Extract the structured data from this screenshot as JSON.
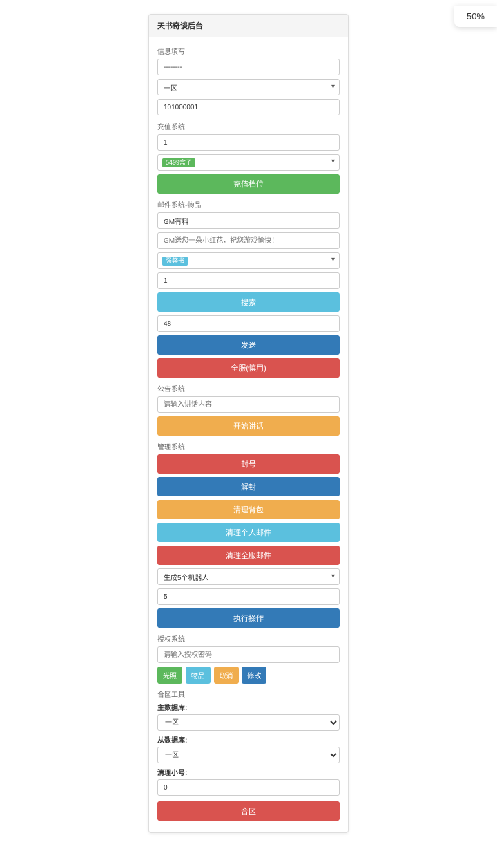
{
  "zoom": "50%",
  "panel": {
    "title": "天书奇谈后台"
  },
  "info_send": {
    "label": "信息填写",
    "mask_value": "--------",
    "zone_selected": "一区",
    "id_value": "101000001"
  },
  "recharge": {
    "label": "充值系统",
    "amount_value": "1",
    "channel_badge": "5499盒子",
    "button": "充值档位"
  },
  "mail_item": {
    "label": "邮件系统-物品",
    "title_value": "GM有料",
    "content_placeholder": "GM送您一朵小红花，祝您游戏愉快！",
    "item_badge": "强弊书",
    "qty_value": "1",
    "search_button": "搜索",
    "val48": "48",
    "send_button": "发送",
    "all_server_button": "全服(慎用)"
  },
  "notice": {
    "label": "公告系统",
    "placeholder": "请输入讲话内容",
    "button": "开始讲话"
  },
  "mgmt": {
    "label": "管理系统",
    "ban": "封号",
    "unban": "解封",
    "clear_bag": "清理背包",
    "clear_personal_mail": "清理个人邮件",
    "clear_all_mail": "清理全服邮件"
  },
  "robot": {
    "select_text": "生成5个机器人",
    "qty_value": "5",
    "exec_button": "执行操作"
  },
  "auth": {
    "label": "授权系统",
    "placeholder": "请输入授权密码",
    "btn1": "光照",
    "btn2": "物品",
    "btn3": "取消",
    "btn4": "修改"
  },
  "merge": {
    "tool_label": "合区工具",
    "main_db_label": "主数据库:",
    "main_db_selected": "一区",
    "sub_db_label": "从数据库:",
    "sub_db_selected": "一区",
    "clear_alt_label": "清理小号:",
    "clear_alt_value": "0",
    "button": "合区"
  }
}
